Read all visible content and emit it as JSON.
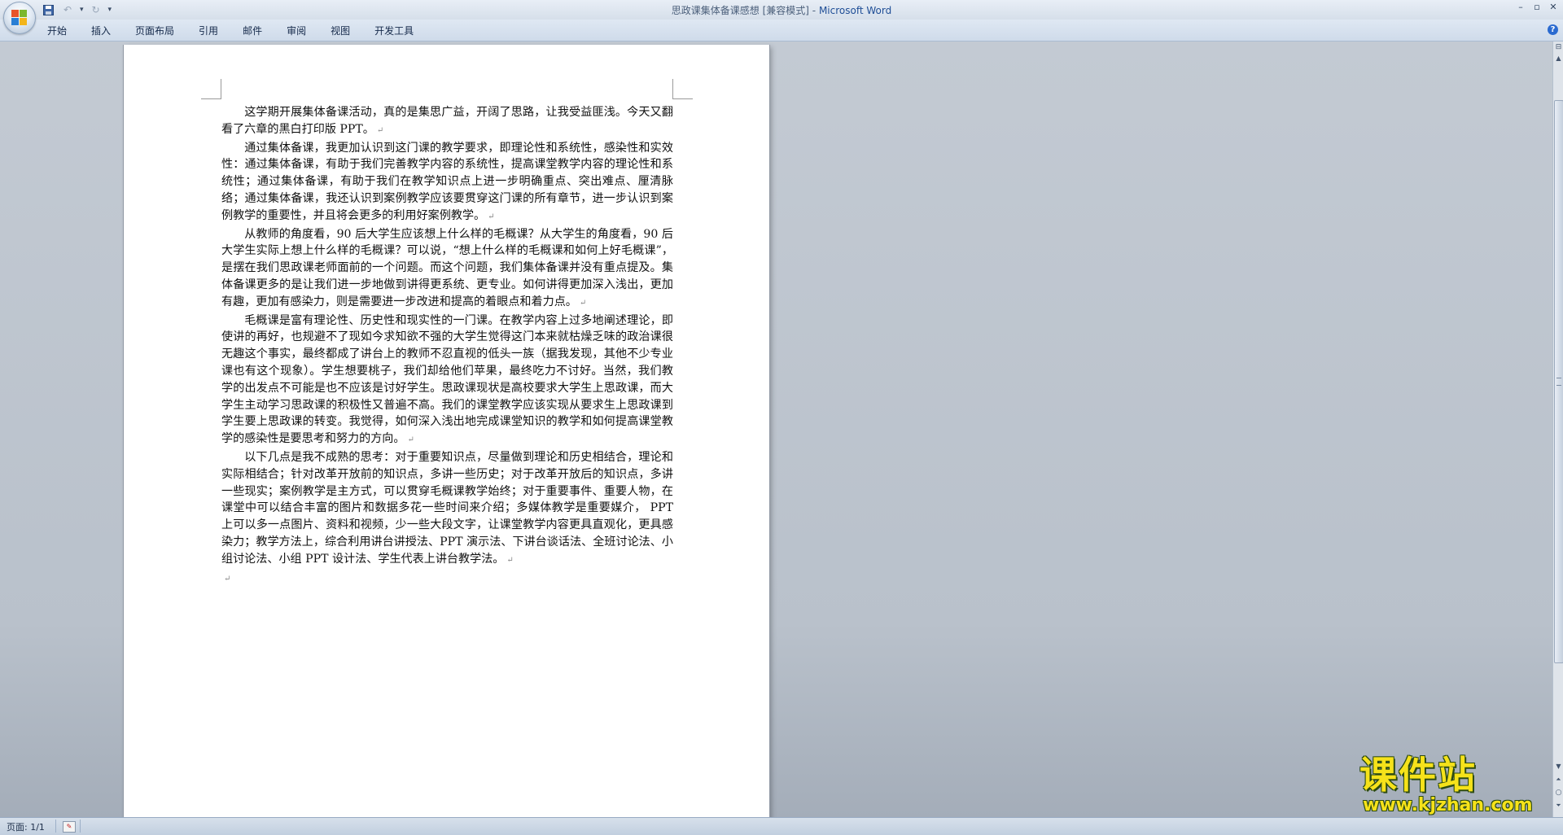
{
  "window": {
    "doc_title": "思政课集体备课感想 [兼容模式]",
    "separator": " - ",
    "app_name": "Microsoft Word"
  },
  "ribbon": {
    "tabs": [
      "开始",
      "插入",
      "页面布局",
      "引用",
      "邮件",
      "审阅",
      "视图",
      "开发工具"
    ]
  },
  "document": {
    "paragraphs": [
      "这学期开展集体备课活动，真的是集思广益，开阔了思路，让我受益匪浅。今天又翻看了六章的黑白打印版 PPT。",
      "通过集体备课，我更加认识到这门课的教学要求，即理论性和系统性，感染性和实效性：通过集体备课，有助于我们完善教学内容的系统性，提高课堂教学内容的理论性和系统性；通过集体备课，有助于我们在教学知识点上进一步明确重点、突出难点、厘清脉络；通过集体备课，我还认识到案例教学应该要贯穿这门课的所有章节，进一步认识到案例教学的重要性，并且将会更多的利用好案例教学。",
      "从教师的角度看，90 后大学生应该想上什么样的毛概课？从大学生的角度看，90 后大学生实际上想上什么样的毛概课？可以说，“想上什么样的毛概课和如何上好毛概课”，是摆在我们思政课老师面前的一个问题。而这个问题，我们集体备课并没有重点提及。集体备课更多的是让我们进一步地做到讲得更系统、更专业。如何讲得更加深入浅出，更加有趣，更加有感染力，则是需要进一步改进和提高的着眼点和着力点。",
      "毛概课是富有理论性、历史性和现实性的一门课。在教学内容上过多地阐述理论，即使讲的再好，也规避不了现如今求知欲不强的大学生觉得这门本来就枯燥乏味的政治课很无趣这个事实，最终都成了讲台上的教师不忍直视的低头一族（据我发现，其他不少专业课也有这个现象）。学生想要桃子，我们却给他们苹果，最终吃力不讨好。当然，我们教学的出发点不可能是也不应该是讨好学生。思政课现状是高校要求大学生上思政课，而大学生主动学习思政课的积极性又普遍不高。我们的课堂教学应该实现从要求生上思政课到学生要上思政课的转变。我觉得，如何深入浅出地完成课堂知识的教学和如何提高课堂教学的感染性是要思考和努力的方向。",
      "以下几点是我不成熟的思考：对于重要知识点，尽量做到理论和历史相结合，理论和实际相结合；针对改革开放前的知识点，多讲一些历史；对于改革开放后的知识点，多讲一些现实；案例教学是主方式，可以贯穿毛概课教学始终；对于重要事件、重要人物，在课堂中可以结合丰富的图片和数据多花一些时间来介绍；多媒体教学是重要媒介，  PPT 上可以多一点图片、资料和视频，少一些大段文字，让课堂教学内容更具直观化，更具感染力；教学方法上，综合利用讲台讲授法、PPT 演示法、下讲台谈话法、全班讨论法、小组讨论法、小组 PPT 设计法、学生代表上讲台教学法。"
    ],
    "paragraph_mark": "↵"
  },
  "statusbar": {
    "page_info": "页面: 1/1"
  },
  "watermark": {
    "brand": "课件站",
    "url": "www.kjzhan.com"
  },
  "icons": {
    "save": "save-icon",
    "undo": "undo-icon",
    "redo": "redo-icon",
    "help": "help-icon",
    "proofing": "proofing-icon"
  },
  "colors": {
    "app_name": "#1f4e96",
    "workspace": "#c3cad3",
    "watermark": "#f6e21a"
  }
}
